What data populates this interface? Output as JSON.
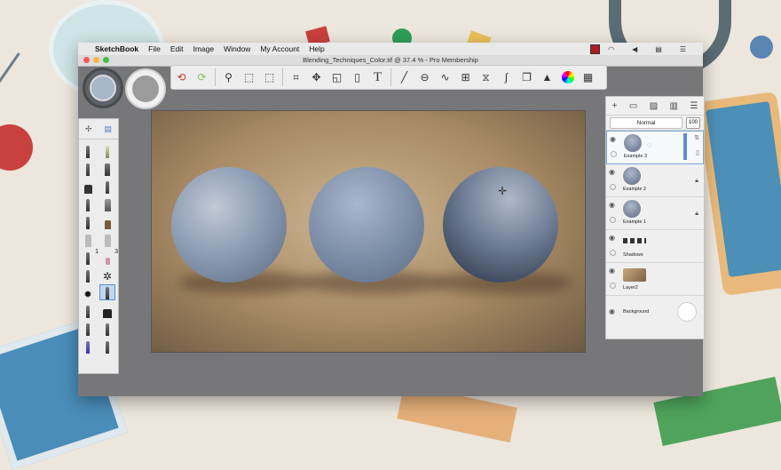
{
  "menubar": {
    "apple": "",
    "items": [
      "SketchBook",
      "File",
      "Edit",
      "Image",
      "Window",
      "My Account",
      "Help"
    ]
  },
  "window": {
    "title": "Blending_Techniques_Color.tif @ 37.4 % - Pro Membership"
  },
  "toolbar": {
    "icons": [
      "undo-icon",
      "redo-icon",
      "zoom-icon",
      "select-icon",
      "transform-icon",
      "crop-icon",
      "move-icon",
      "distort-icon",
      "fill-icon",
      "text-icon",
      "ruler-icon",
      "ellipse-icon",
      "curve-icon",
      "perspective-icon",
      "symmetry-icon",
      "stroke-icon",
      "copy-icon",
      "brush-palette-icon",
      "color-wheel-icon",
      "layer-grid-icon"
    ]
  },
  "brushes": {
    "superscripts": [
      "1",
      "3"
    ]
  },
  "layers": {
    "blend_mode": "Normal",
    "opacity": "100",
    "items": [
      {
        "name": "Example 3",
        "selected": true,
        "locked": false
      },
      {
        "name": "Example 2",
        "selected": false,
        "locked": true
      },
      {
        "name": "Example 1",
        "selected": false,
        "locked": true
      },
      {
        "name": "Shadows",
        "selected": false,
        "locked": false
      },
      {
        "name": "Layer2",
        "selected": false,
        "locked": false
      },
      {
        "name": "Background",
        "selected": false,
        "locked": false
      }
    ]
  },
  "colors": {
    "accent": "#5b8fd0",
    "record": "#b11a22"
  }
}
